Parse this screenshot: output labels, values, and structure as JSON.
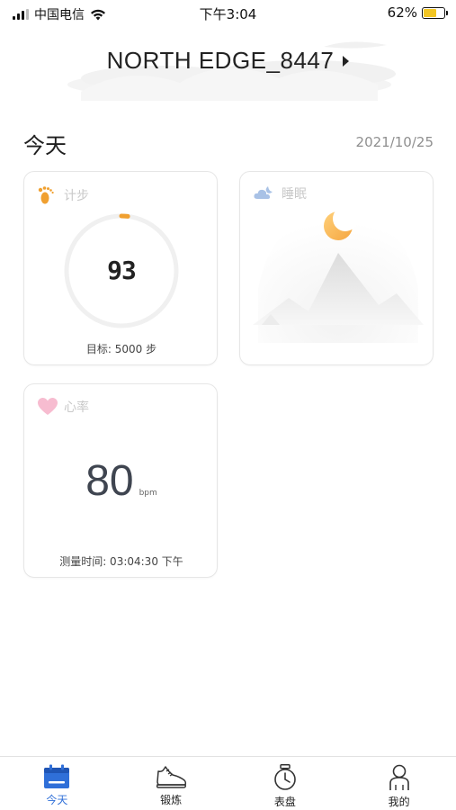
{
  "status_bar": {
    "carrier": "中国电信",
    "time": "下午3:04",
    "battery_percent": "62%",
    "battery_level": 0.62,
    "battery_color": "#f3c623"
  },
  "header": {
    "device_name": "NORTH EDGE_8447"
  },
  "day": {
    "title": "今天",
    "date": "2021/10/25"
  },
  "cards": {
    "steps": {
      "label": "计步",
      "value": "93",
      "goal": "目标: 5000 步",
      "progress_fraction": 0.0186,
      "accent_color": "#f0a030",
      "icon": "footprints-icon"
    },
    "sleep": {
      "label": "睡眠",
      "icon": "sleep-cloud-icon"
    },
    "heart": {
      "label": "心率",
      "value": "80",
      "unit": "bpm",
      "measured_time": "测量时间: 03:04:30 下午",
      "icon": "heart-icon"
    }
  },
  "tabbar": {
    "tabs": [
      {
        "label": "今天",
        "icon": "calendar-icon",
        "active": true
      },
      {
        "label": "锻炼",
        "icon": "sneaker-icon",
        "active": false
      },
      {
        "label": "表盘",
        "icon": "watch-icon",
        "active": false
      },
      {
        "label": "我的",
        "icon": "person-icon",
        "active": false
      }
    ],
    "active_color": "#2f6fd8"
  }
}
